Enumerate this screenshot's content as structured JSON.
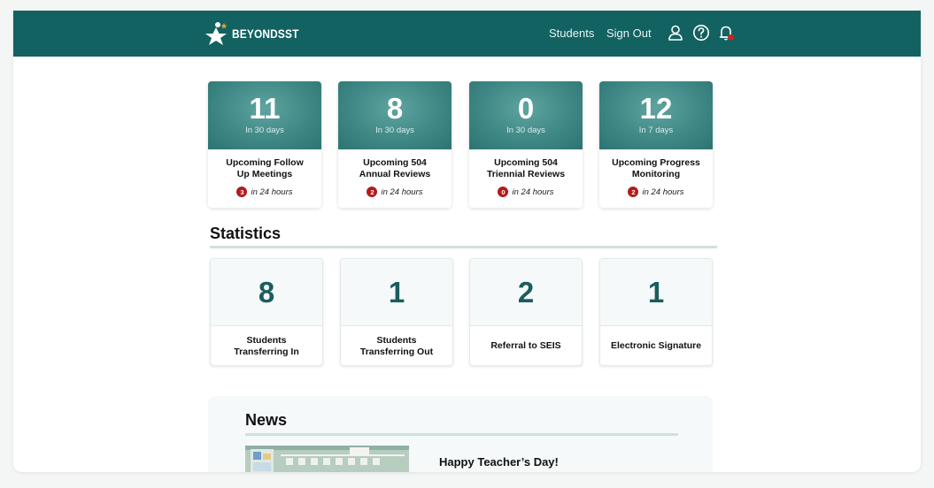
{
  "header": {
    "brand": "BEYONDSST",
    "nav": {
      "students": "Students",
      "sign_out": "Sign Out"
    },
    "icons": [
      "user-icon",
      "help-icon",
      "bell-icon"
    ],
    "colors": {
      "bar": "#136262",
      "notification_dot": "#d32222"
    }
  },
  "upcoming": [
    {
      "count": "11",
      "window": "In 30 days",
      "label_line1": "Upcoming Follow",
      "label_line2": "Up Meetings",
      "soon_count": "3",
      "soon_text": "in 24 hours"
    },
    {
      "count": "8",
      "window": "In 30 days",
      "label_line1": "Upcoming 504",
      "label_line2": "Annual Reviews",
      "soon_count": "2",
      "soon_text": "in 24 hours"
    },
    {
      "count": "0",
      "window": "In 30 days",
      "label_line1": "Upcoming 504",
      "label_line2": "Triennial Reviews",
      "soon_count": "0",
      "soon_text": "in 24 hours"
    },
    {
      "count": "12",
      "window": "In 7 days",
      "label_line1": "Upcoming Progress",
      "label_line2": "Monitoring",
      "soon_count": "2",
      "soon_text": "in 24 hours"
    }
  ],
  "statistics": {
    "title": "Statistics",
    "items": [
      {
        "value": "8",
        "label_line1": "Students",
        "label_line2": "Transferring In"
      },
      {
        "value": "1",
        "label_line1": "Students",
        "label_line2": "Transferring Out"
      },
      {
        "value": "2",
        "label_line1": "Referral to SEIS",
        "label_line2": ""
      },
      {
        "value": "1",
        "label_line1": "Electronic Signature",
        "label_line2": ""
      }
    ]
  },
  "news": {
    "title": "News",
    "items": [
      {
        "headline": "Happy Teacher’s Day!"
      }
    ]
  }
}
